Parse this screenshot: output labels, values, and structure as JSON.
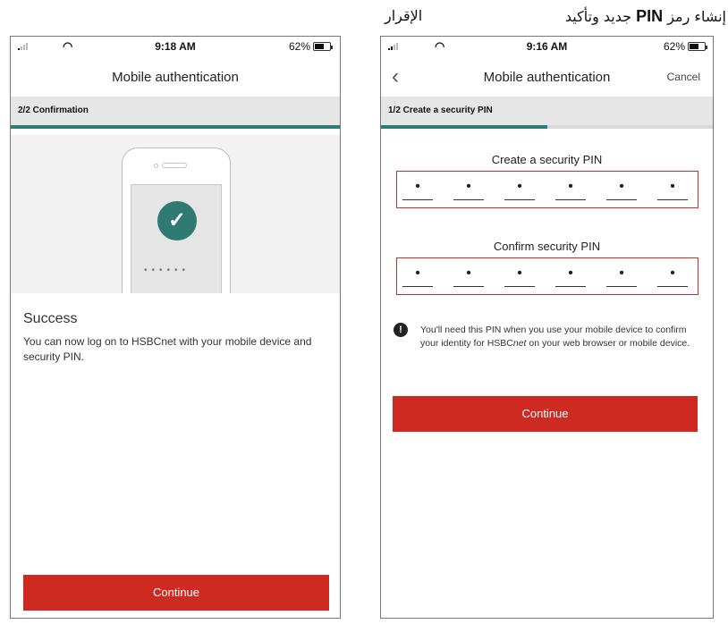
{
  "caption": {
    "part_a": "إنشاء رمز",
    "part_b": "PIN",
    "part_c": "جديد وتأكيد",
    "part_d": "الإقرار"
  },
  "left_screen": {
    "status": {
      "time": "9:18 AM",
      "battery": "62%"
    },
    "nav_title": "Mobile authentication",
    "step_label": "2/2 Confirmation",
    "progress": 1.0,
    "illustration": {
      "pin_dots": "••••••",
      "icon": "check-icon"
    },
    "success_title": "Success",
    "success_body": "You can now log on to HSBCnet with your mobile device and security PIN.",
    "continue_label": "Continue"
  },
  "right_screen": {
    "status": {
      "time": "9:16 AM",
      "battery": "62%"
    },
    "nav_title": "Mobile authentication",
    "cancel_label": "Cancel",
    "step_label": "1/2 Create a security PIN",
    "progress": 0.5,
    "create_pin_label": "Create a security PIN",
    "confirm_pin_label": "Confirm security PIN",
    "pin_placeholder": "•",
    "info_text_1": "You'll need this PIN when you use your mobile device to confirm your identity for HSBC",
    "info_text_em": "net",
    "info_text_2": " on your web browser or mobile device.",
    "continue_label": "Continue"
  },
  "colors": {
    "accent_red": "#cf2a22",
    "progress_teal": "#2e7d73"
  }
}
